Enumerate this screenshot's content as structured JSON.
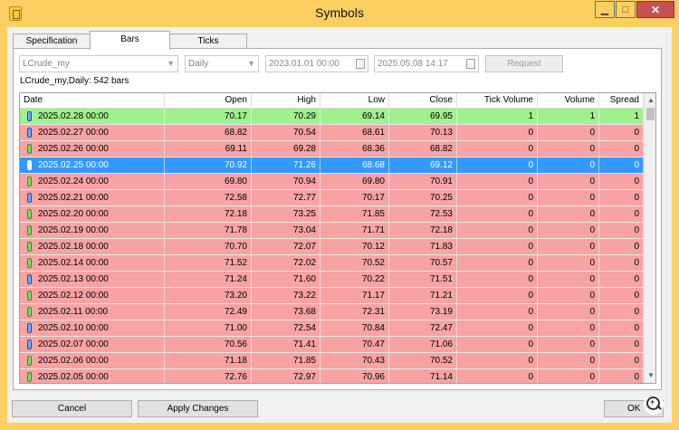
{
  "window": {
    "title": "Symbols",
    "controls": {
      "minimize": "▁",
      "maximize": "□",
      "close": "✕"
    },
    "frame_color": "#fdcf63"
  },
  "tabs": [
    {
      "label": "Specification",
      "active": false
    },
    {
      "label": "Bars",
      "active": true
    },
    {
      "label": "Ticks",
      "active": false
    }
  ],
  "toolbar": {
    "symbol": "LCrude_my",
    "timeframe": "Daily",
    "date_from": "2023.01.01 00:00",
    "date_to": "2025.05.08 14:17",
    "request_label": "Request"
  },
  "summary": "LCrude_my,Daily: 542 bars",
  "table": {
    "columns": [
      "Date",
      "Open",
      "High",
      "Low",
      "Close",
      "Tick Volume",
      "Volume",
      "Spread"
    ],
    "row_colors": {
      "up": "#9ff08e",
      "down": "#f7a3a3",
      "selected": "#3399ff"
    },
    "rows": [
      {
        "date": "2025.02.28 00:00",
        "open": "70.17",
        "high": "70.29",
        "low": "69.14",
        "close": "69.95",
        "tick_volume": "1",
        "volume": "1",
        "spread": "1",
        "state": "up",
        "icon": "blue"
      },
      {
        "date": "2025.02.27 00:00",
        "open": "68.82",
        "high": "70.54",
        "low": "68.61",
        "close": "70.13",
        "tick_volume": "0",
        "volume": "0",
        "spread": "0",
        "state": "down",
        "icon": "blue"
      },
      {
        "date": "2025.02.26 00:00",
        "open": "69.11",
        "high": "69.28",
        "low": "68.36",
        "close": "68.82",
        "tick_volume": "0",
        "volume": "0",
        "spread": "0",
        "state": "down",
        "icon": "green"
      },
      {
        "date": "2025.02.25 00:00",
        "open": "70.92",
        "high": "71.26",
        "low": "68.68",
        "close": "69.12",
        "tick_volume": "0",
        "volume": "0",
        "spread": "0",
        "state": "selected",
        "icon": "blue"
      },
      {
        "date": "2025.02.24 00:00",
        "open": "69.80",
        "high": "70.94",
        "low": "69.80",
        "close": "70.91",
        "tick_volume": "0",
        "volume": "0",
        "spread": "0",
        "state": "down",
        "icon": "green"
      },
      {
        "date": "2025.02.21 00:00",
        "open": "72.58",
        "high": "72.77",
        "low": "70.17",
        "close": "70.25",
        "tick_volume": "0",
        "volume": "0",
        "spread": "0",
        "state": "down",
        "icon": "blue"
      },
      {
        "date": "2025.02.20 00:00",
        "open": "72.18",
        "high": "73.25",
        "low": "71.85",
        "close": "72.53",
        "tick_volume": "0",
        "volume": "0",
        "spread": "0",
        "state": "down",
        "icon": "green"
      },
      {
        "date": "2025.02.19 00:00",
        "open": "71.78",
        "high": "73.04",
        "low": "71.71",
        "close": "72.18",
        "tick_volume": "0",
        "volume": "0",
        "spread": "0",
        "state": "down",
        "icon": "green"
      },
      {
        "date": "2025.02.18 00:00",
        "open": "70.70",
        "high": "72.07",
        "low": "70.12",
        "close": "71.83",
        "tick_volume": "0",
        "volume": "0",
        "spread": "0",
        "state": "down",
        "icon": "green"
      },
      {
        "date": "2025.02.14 00:00",
        "open": "71.52",
        "high": "72.02",
        "low": "70.52",
        "close": "70.57",
        "tick_volume": "0",
        "volume": "0",
        "spread": "0",
        "state": "down",
        "icon": "green"
      },
      {
        "date": "2025.02.13 00:00",
        "open": "71.24",
        "high": "71.60",
        "low": "70.22",
        "close": "71.51",
        "tick_volume": "0",
        "volume": "0",
        "spread": "0",
        "state": "down",
        "icon": "blue"
      },
      {
        "date": "2025.02.12 00:00",
        "open": "73.20",
        "high": "73.22",
        "low": "71.17",
        "close": "71.21",
        "tick_volume": "0",
        "volume": "0",
        "spread": "0",
        "state": "down",
        "icon": "green"
      },
      {
        "date": "2025.02.11 00:00",
        "open": "72.49",
        "high": "73.68",
        "low": "72.31",
        "close": "73.19",
        "tick_volume": "0",
        "volume": "0",
        "spread": "0",
        "state": "down",
        "icon": "green"
      },
      {
        "date": "2025.02.10 00:00",
        "open": "71.00",
        "high": "72.54",
        "low": "70.84",
        "close": "72.47",
        "tick_volume": "0",
        "volume": "0",
        "spread": "0",
        "state": "down",
        "icon": "blue"
      },
      {
        "date": "2025.02.07 00:00",
        "open": "70.56",
        "high": "71.41",
        "low": "70.47",
        "close": "71.06",
        "tick_volume": "0",
        "volume": "0",
        "spread": "0",
        "state": "down",
        "icon": "blue"
      },
      {
        "date": "2025.02.06 00:00",
        "open": "71.18",
        "high": "71.85",
        "low": "70.43",
        "close": "70.52",
        "tick_volume": "0",
        "volume": "0",
        "spread": "0",
        "state": "down",
        "icon": "green"
      },
      {
        "date": "2025.02.05 00:00",
        "open": "72.76",
        "high": "72.97",
        "low": "70.96",
        "close": "71.14",
        "tick_volume": "0",
        "volume": "0",
        "spread": "0",
        "state": "down",
        "icon": "green"
      }
    ]
  },
  "footer": {
    "cancel_label": "Cancel",
    "apply_label": "Apply Changes",
    "ok_label": "OK"
  }
}
